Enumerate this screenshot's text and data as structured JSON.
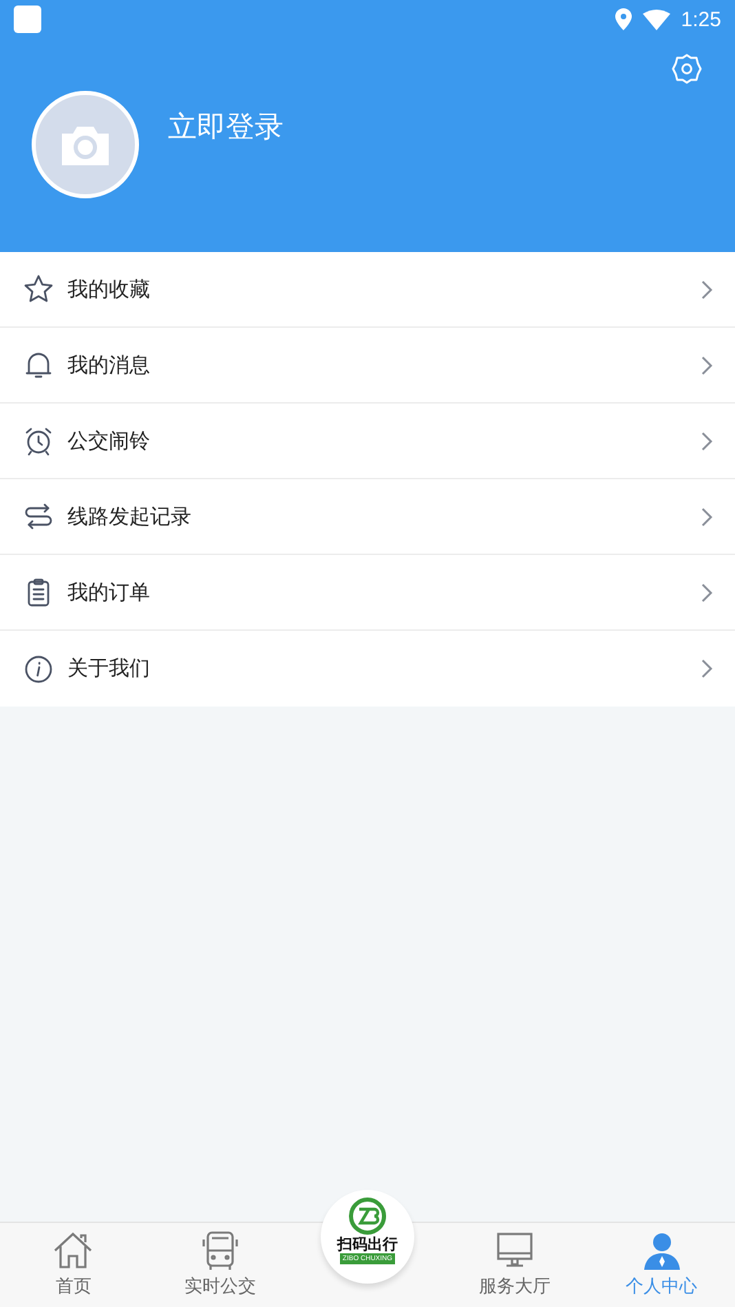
{
  "status_bar": {
    "time": "1:25"
  },
  "header": {
    "login": "立即登录"
  },
  "menu": [
    {
      "kind": "star",
      "label": "我的收藏"
    },
    {
      "kind": "bell",
      "label": "我的消息"
    },
    {
      "kind": "alarm",
      "label": "公交闹铃"
    },
    {
      "kind": "route",
      "label": "线路发起记录"
    },
    {
      "kind": "clipboard",
      "label": "我的订单"
    },
    {
      "kind": "info",
      "label": "关于我们"
    }
  ],
  "tab_bar": {
    "tabs": [
      {
        "kind": "home",
        "label": "首页",
        "selected": false
      },
      {
        "kind": "bus",
        "label": "实时公交",
        "selected": false
      },
      {
        "kind": "scan",
        "title": "扫码出行",
        "subtitle": "ZIBO CHUXING",
        "selected": false
      },
      {
        "kind": "monitor",
        "label": "服务大厅",
        "selected": false
      },
      {
        "kind": "person",
        "label": "个人中心",
        "selected": true
      }
    ]
  }
}
